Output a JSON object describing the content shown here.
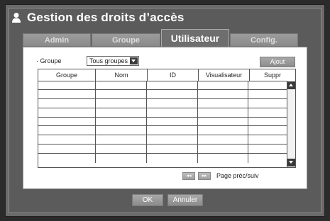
{
  "window": {
    "title": "Gestion des droits d’accès",
    "icon": "user-icon"
  },
  "tabs": [
    {
      "label": "Admin",
      "active": false
    },
    {
      "label": "Groupe",
      "active": false
    },
    {
      "label": "Utilisateur",
      "active": true
    },
    {
      "label": "Config.",
      "active": false
    }
  ],
  "filter": {
    "label": "· Groupe",
    "selected": "Tous groupes"
  },
  "add_button": "Ajout",
  "table": {
    "columns": [
      "Groupe",
      "Nom",
      "ID",
      "Visualisateur",
      "Suppr"
    ],
    "row_count": 9
  },
  "pager": {
    "prev_icon": "double-left-icon",
    "next_icon": "double-right-icon",
    "label": "Page préc/suiv"
  },
  "footer": {
    "ok": "OK",
    "cancel": "Annuler"
  }
}
